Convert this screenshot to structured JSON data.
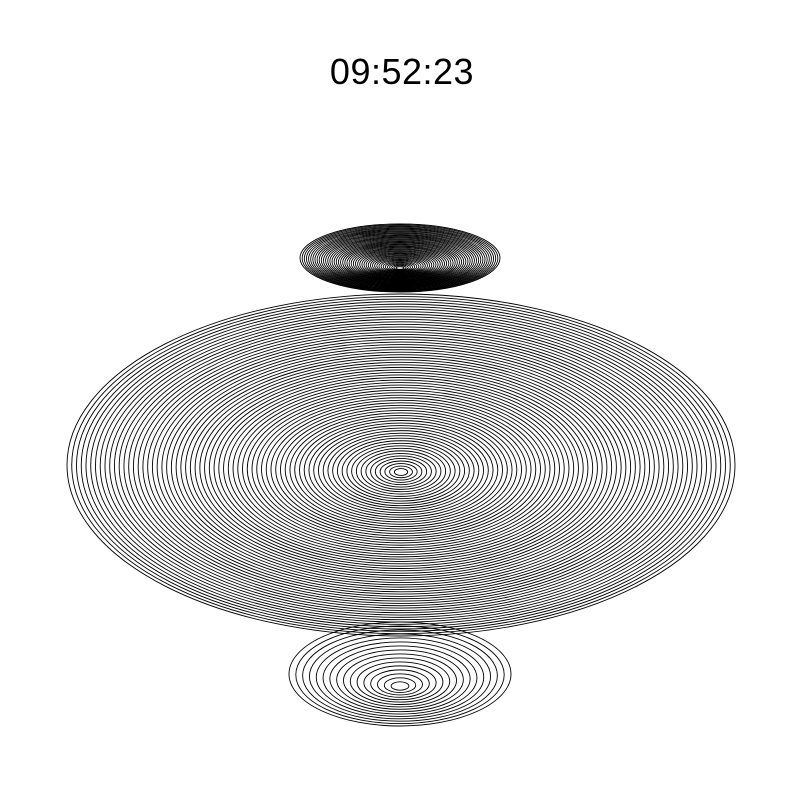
{
  "clock": {
    "time": "09:52:23"
  },
  "colors": {
    "background": "#ffffff",
    "stroke": "#000000"
  }
}
